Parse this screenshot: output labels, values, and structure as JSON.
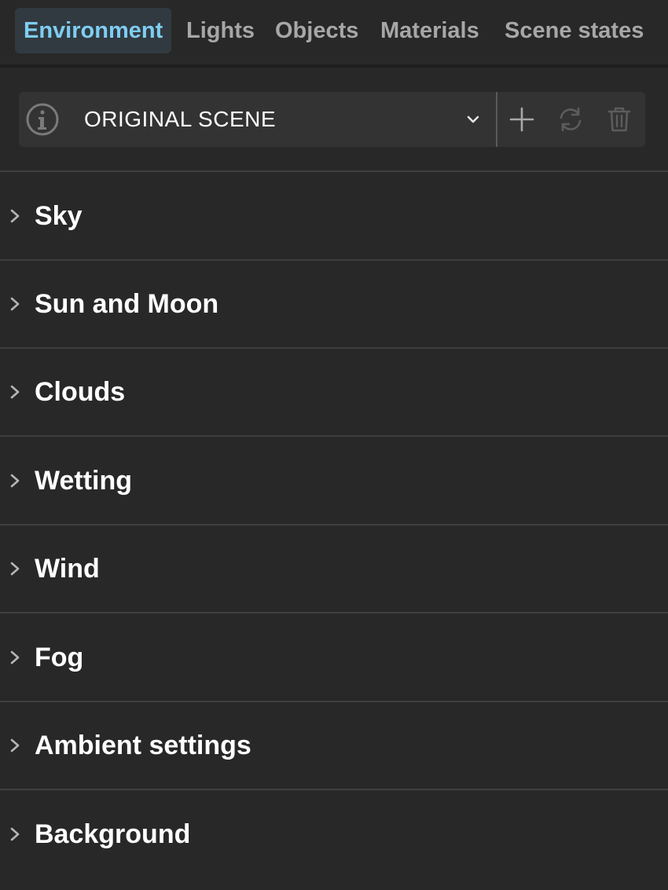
{
  "tabs": [
    {
      "label": "Environment",
      "active": true
    },
    {
      "label": "Lights",
      "active": false
    },
    {
      "label": "Objects",
      "active": false
    },
    {
      "label": "Materials",
      "active": false
    },
    {
      "label": "Scene states",
      "active": false
    }
  ],
  "scene": {
    "selected": "ORIGINAL SCENE",
    "icons": [
      "info-icon",
      "chevron-down-icon",
      "plus-icon",
      "refresh-icon",
      "trash-icon"
    ]
  },
  "sections": [
    {
      "label": "Sky"
    },
    {
      "label": "Sun and Moon"
    },
    {
      "label": "Clouds"
    },
    {
      "label": "Wetting"
    },
    {
      "label": "Wind"
    },
    {
      "label": "Fog"
    },
    {
      "label": "Ambient settings"
    },
    {
      "label": "Background"
    }
  ],
  "colors": {
    "background": "#282828",
    "active_tab_text": "#7fcdf2",
    "active_tab_bg": "#313a40",
    "inactive_tab_text": "#a7a7a7",
    "scene_bar_bg": "#333333"
  }
}
